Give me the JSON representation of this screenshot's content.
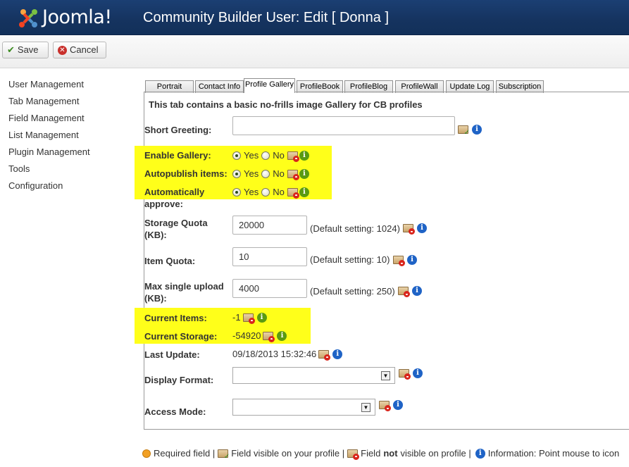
{
  "header": {
    "logo_text": "Joomla!",
    "title": "Community Builder User: Edit [ Donna ]"
  },
  "toolbar": {
    "save_label": "Save",
    "cancel_label": "Cancel"
  },
  "sidebar": {
    "items": [
      {
        "label": "User Management"
      },
      {
        "label": "Tab Management"
      },
      {
        "label": "Field Management"
      },
      {
        "label": "List Management"
      },
      {
        "label": "Plugin Management"
      },
      {
        "label": "Tools"
      },
      {
        "label": "Configuration"
      }
    ]
  },
  "tabs": [
    {
      "label": "Portrait"
    },
    {
      "label": "Contact Info"
    },
    {
      "label": "Profile Gallery",
      "active": true
    },
    {
      "label": "ProfileBook"
    },
    {
      "label": "ProfileBlog"
    },
    {
      "label": "ProfileWall"
    },
    {
      "label": "Update Log"
    },
    {
      "label": "Subscription"
    }
  ],
  "form": {
    "description": "This tab contains a basic no-frills image Gallery for CB profiles",
    "short_greeting": {
      "label": "Short Greeting:",
      "value": ""
    },
    "yes_label": "Yes",
    "no_label": "No",
    "enable_gallery": {
      "label": "Enable Gallery:",
      "selected": "Yes"
    },
    "autopublish": {
      "label": "Autopublish items:",
      "selected": "Yes"
    },
    "auto_approve": {
      "label": "Automatically approve:",
      "selected": "Yes"
    },
    "storage_quota": {
      "label": "Storage Quota (KB):",
      "value": "20000",
      "default": "(Default setting: 1024)"
    },
    "item_quota": {
      "label": "Item Quota:",
      "value": "10",
      "default": "(Default setting: 10)"
    },
    "max_upload": {
      "label": "Max single upload (KB):",
      "value": "4000",
      "default": "(Default setting: 250)"
    },
    "current_items": {
      "label": "Current Items:",
      "value": "-1"
    },
    "current_storage": {
      "label": "Current Storage:",
      "value": "-54920"
    },
    "last_update": {
      "label": "Last Update:",
      "value": "09/18/2013 15:32:46"
    },
    "display_format": {
      "label": "Display Format:",
      "value": ""
    },
    "access_mode": {
      "label": "Access Mode:",
      "value": ""
    }
  },
  "legend": {
    "required": "Required field |",
    "visible": "Field visible on your profile |",
    "field_word": "Field",
    "not_word": "not",
    "not_visible_rest": "visible on profile |",
    "information": "Information: Point mouse to icon"
  },
  "colors": {
    "header_bg": "#15335f",
    "highlight": "#ffff1a",
    "info_blue": "#1f63c6",
    "info_green": "#5a9a12"
  }
}
